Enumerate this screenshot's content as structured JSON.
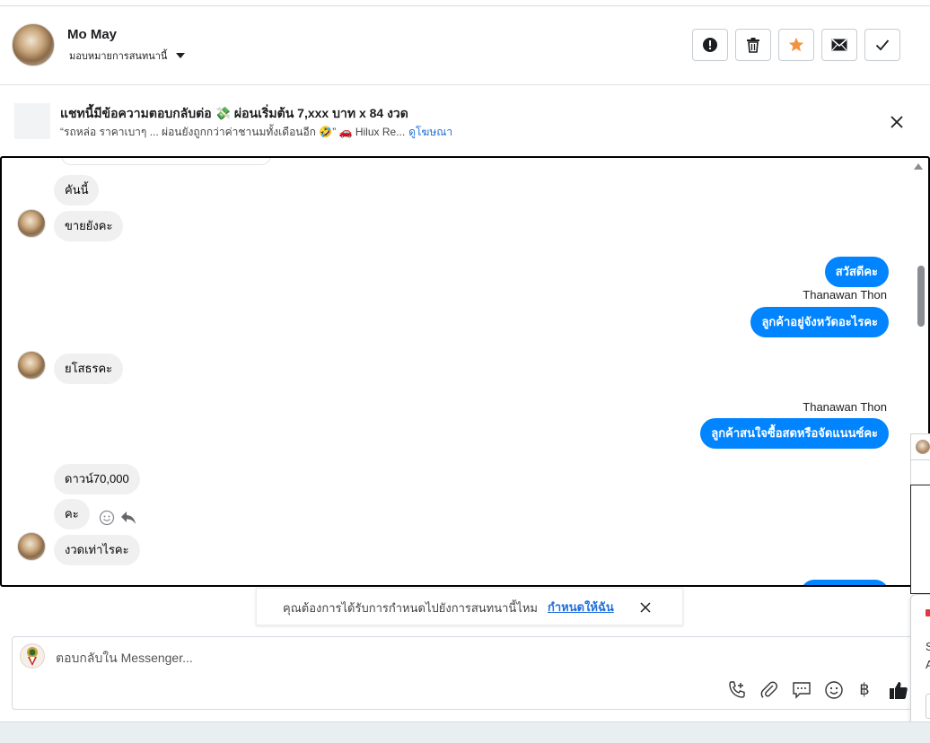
{
  "header": {
    "contact_name": "Mo May",
    "assign_label": "มอบหมายการสนทนานี้",
    "actions": [
      {
        "name": "spam",
        "icon": "alert-icon"
      },
      {
        "name": "delete",
        "icon": "trash-icon"
      },
      {
        "name": "star",
        "icon": "star-icon",
        "color": "#f5923e"
      },
      {
        "name": "mark-unread",
        "icon": "envelope-icon"
      },
      {
        "name": "mark-done",
        "icon": "check-icon"
      }
    ]
  },
  "ad": {
    "title": "แชทนี้มีข้อความตอบกลับต่อ 💸 ผ่อนเริ่มต้น 7,xxx บาท x 84 งวด",
    "subtitle": "“รถหล่อ ราคาเบาๆ ... ผ่อนยังถูกกว่าค่าชานมทั้งเดือนอีก 🤣” 🚗 Hilux Re...",
    "link": "ดูโฆษณา"
  },
  "messages": [
    {
      "dir": "in",
      "text": "คันนี้"
    },
    {
      "dir": "in",
      "text": "ขายยังคะ"
    },
    {
      "dir": "out",
      "text": "สวัสดีคะ"
    },
    {
      "dir": "out",
      "sender": "Thanawan Thon",
      "text": "ลูกค้าอยู่จังหวัดอะไรคะ"
    },
    {
      "dir": "in",
      "text": "ยโสธรคะ"
    },
    {
      "dir": "out",
      "sender": "Thanawan Thon",
      "text": "ลูกค้าสนใจซื้อสดหรือจัดแนนซ์คะ"
    },
    {
      "dir": "in",
      "text": "ดาวน์70,000"
    },
    {
      "dir": "in",
      "text": "คะ"
    },
    {
      "dir": "in",
      "text": "งวดเท่าไรคะ"
    }
  ],
  "assign_notice": {
    "text": "คุณต้องการได้รับการกำหนดไปยังการสนทนานี้ไหม",
    "link": "กำหนดให้ฉัน"
  },
  "composer": {
    "placeholder": "ตอบกลับใน Messenger...",
    "tools": [
      "call-add-icon",
      "attachment-icon",
      "saved-reply-icon",
      "emoji-icon",
      "baht-icon",
      "thumbs-up-icon"
    ],
    "baht_symbol": "฿"
  },
  "side_panel": {
    "letters": [
      "S",
      "A"
    ]
  },
  "colors": {
    "outgoing_bubble": "#0084ff",
    "incoming_bubble": "#f0f0f0",
    "link": "#216fdb",
    "star": "#f5923e"
  }
}
